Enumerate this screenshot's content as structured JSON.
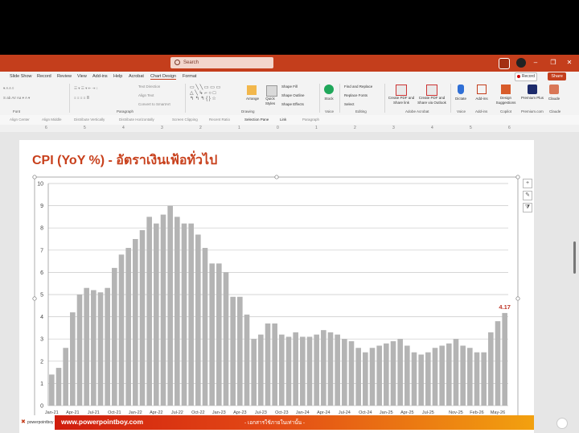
{
  "titlebar": {
    "search_placeholder": "Search",
    "window_controls": [
      "–",
      "❐",
      "✕"
    ]
  },
  "menu": {
    "items": [
      "Slide Show",
      "Record",
      "Review",
      "View",
      "Add-ins",
      "Help",
      "Acrobat",
      "Chart Design",
      "Format"
    ],
    "active": "Chart Design",
    "record_label": "Record",
    "share_label": "Share"
  },
  "ribbon": {
    "groups": [
      "Font",
      "Paragraph",
      "Drawing",
      "Voice",
      "Editing",
      "Adobe Acrobat",
      "Voice",
      "Add-ins",
      "Copilot",
      "Premium.com",
      "Claude"
    ],
    "paragraph_items": [
      "Text Direction",
      "Align Text",
      "Convert to SmartArt"
    ],
    "drawing_items": [
      "Arrange",
      "Quick Styles",
      "Shape Fill",
      "Shape Outline",
      "Shape Effects"
    ],
    "editing_items": [
      "Find and Replace",
      "Replace Fonts",
      "Select"
    ],
    "stock_label": "Stock",
    "acrobat_items": [
      "Create PDF and Share link",
      "Create PDF and Share via Outlook"
    ],
    "voice_label": "Dictate",
    "addins_label": "Add-ins",
    "design_label": "Design Suggestions",
    "premium_label": "Premium Plus",
    "claude_label": "Claude"
  },
  "toolrow": [
    "Align Center",
    "Align Middle",
    "Distribute Vertically",
    "Distribute Horizontally",
    "Screen Clipping",
    "Recent Ratio",
    "Selection Pane",
    "Link",
    "Paragraph"
  ],
  "ruler_ticks": [
    "6",
    "5",
    "4",
    "3",
    "2",
    "1",
    "0",
    "1",
    "2",
    "3",
    "4",
    "5",
    "6"
  ],
  "slide": {
    "title": "CPI (YoY %) - อัตราเงินเฟ้อทั่วไป",
    "footer_logo": "powerpointboy",
    "footer_url": "www.powerpointboy.com",
    "footer_mid": "- เอกสารใช้ภายในเท่านั้น -"
  },
  "colors": {
    "accent": "#c43e1c",
    "title": "#c8401c",
    "bar": "#b4b4b4",
    "last_label": "#c0392b"
  },
  "chart_data": {
    "type": "bar",
    "title": "",
    "ylim": [
      0,
      10
    ],
    "yticks": [
      0,
      1,
      2,
      3,
      4,
      5,
      6,
      7,
      8,
      9,
      10
    ],
    "xtick_labels": [
      "Jan-21",
      "Apr-21",
      "Jul-21",
      "Oct-21",
      "Jan-22",
      "Apr-22",
      "Jul-22",
      "Oct-22",
      "Jan-23",
      "Apr-23",
      "Jul-23",
      "Oct-23",
      "Jan-24",
      "Apr-24",
      "Jul-24",
      "Oct-24",
      "Jan-25",
      "Apr-25",
      "Jul-25",
      "Nov-25",
      "Feb-26",
      "May-26"
    ],
    "values": [
      1.4,
      1.7,
      2.6,
      4.2,
      5.0,
      5.3,
      5.2,
      5.1,
      5.3,
      6.2,
      6.8,
      7.1,
      7.5,
      7.9,
      8.5,
      8.2,
      8.6,
      9.0,
      8.5,
      8.2,
      8.2,
      7.7,
      7.1,
      6.4,
      6.4,
      6.0,
      4.9,
      4.9,
      4.1,
      3.0,
      3.2,
      3.7,
      3.7,
      3.2,
      3.1,
      3.3,
      3.1,
      3.1,
      3.2,
      3.4,
      3.3,
      3.2,
      3.0,
      2.9,
      2.6,
      2.4,
      2.6,
      2.7,
      2.8,
      2.9,
      3.0,
      2.7,
      2.4,
      2.3,
      2.4,
      2.6,
      2.7,
      2.8,
      3.0,
      2.7,
      2.6,
      2.4,
      2.4,
      3.3,
      3.8,
      4.17
    ],
    "last_value_label": "4.17",
    "grid": true
  }
}
